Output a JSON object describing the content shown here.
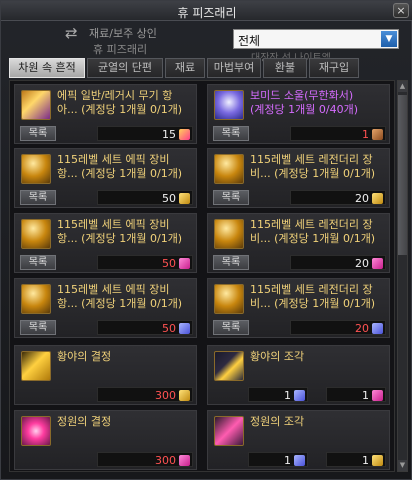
{
  "window": {
    "title": "휴 피즈래리",
    "close_label": "×"
  },
  "shop_info": {
    "line1": "재료/보주 상인",
    "line2": "휴 피즈래리"
  },
  "filter": {
    "selected": "전체",
    "hint": "대장장 선 나이트엘"
  },
  "tabs": [
    {
      "label": "차원 속 흔적",
      "active": true
    },
    {
      "label": "균열의 단편",
      "active": false
    },
    {
      "label": "재료",
      "active": false
    },
    {
      "label": "마법부여",
      "active": false
    },
    {
      "label": "환불",
      "active": false
    },
    {
      "label": "재구입",
      "active": false
    }
  ],
  "list_button_label": "목록",
  "items": [
    {
      "name1": "에픽 일반/레거시 무기 항",
      "name2": "아... (계정당 1개월 0/1개)",
      "name_color": "gold",
      "icon": "epic-chest-icon",
      "costs": [
        {
          "amount": "15",
          "color": "white",
          "currency_icon": "pink-gold-currency-icon"
        }
      ]
    },
    {
      "name1": "보미드 소울(무한화서)",
      "name2": "(계정당 1개월 0/40개)",
      "name_color": "purple",
      "icon": "bomide-soul-icon",
      "costs": [
        {
          "amount": "1",
          "color": "red",
          "currency_icon": "brown-currency-icon"
        }
      ]
    },
    {
      "name1": "115레벨 세트 에픽 장비",
      "name2": "항... (계정당 1개월 0/1개)",
      "name_color": "gold",
      "icon": "set-epic-icon",
      "costs": [
        {
          "amount": "50",
          "color": "white",
          "currency_icon": "gold-shard-currency-icon"
        }
      ]
    },
    {
      "name1": "115레벨 세트 레전더리 장",
      "name2": "비... (계정당 1개월 0/1개)",
      "name_color": "gold",
      "icon": "set-legendary-icon",
      "costs": [
        {
          "amount": "20",
          "color": "white",
          "currency_icon": "gold-shard-currency-icon"
        }
      ]
    },
    {
      "name1": "115레벨 세트 에픽 장비",
      "name2": "항... (계정당 1개월 0/1개)",
      "name_color": "gold",
      "icon": "set-epic-icon",
      "costs": [
        {
          "amount": "50",
          "color": "red",
          "currency_icon": "pink-shard-currency-icon"
        }
      ]
    },
    {
      "name1": "115레벨 세트 레전더리 장",
      "name2": "비... (계정당 1개월 0/1개)",
      "name_color": "gold",
      "icon": "set-legendary-icon",
      "costs": [
        {
          "amount": "20",
          "color": "white",
          "currency_icon": "pink-shard-currency-icon"
        }
      ]
    },
    {
      "name1": "115레벨 세트 에픽 장비",
      "name2": "항... (계정당 1개월 0/1개)",
      "name_color": "gold",
      "icon": "set-epic-icon",
      "costs": [
        {
          "amount": "50",
          "color": "red",
          "currency_icon": "blue-crystal-currency-icon"
        }
      ]
    },
    {
      "name1": "115레벨 세트 레전더리 장",
      "name2": "비... (계정당 1개월 0/1개)",
      "name_color": "gold",
      "icon": "set-legendary-icon",
      "costs": [
        {
          "amount": "20",
          "color": "red",
          "currency_icon": "blue-crystal-currency-icon"
        }
      ]
    },
    {
      "name1": "황야의 결정",
      "name2": "",
      "name_color": "gold",
      "icon": "wilderness-crystal-icon",
      "costs": [
        {
          "amount": "300",
          "color": "red",
          "currency_icon": "gold-shard-currency-icon"
        }
      ]
    },
    {
      "name1": "황야의 조각",
      "name2": "",
      "name_color": "gold",
      "icon": "wilderness-shard-icon",
      "costs": [
        {
          "amount": "1",
          "color": "white",
          "currency_icon": "blue-crystal-currency-icon"
        },
        {
          "amount": "1",
          "color": "white",
          "currency_icon": "pink-shard-currency-icon"
        }
      ]
    },
    {
      "name1": "정원의 결정",
      "name2": "",
      "name_color": "gold",
      "icon": "garden-crystal-icon",
      "costs": [
        {
          "amount": "300",
          "color": "red",
          "currency_icon": "pink-shard-currency-icon"
        }
      ]
    },
    {
      "name1": "정원의 조각",
      "name2": "",
      "name_color": "gold",
      "icon": "garden-shard-icon",
      "costs": [
        {
          "amount": "1",
          "color": "white",
          "currency_icon": "blue-crystal-currency-icon"
        },
        {
          "amount": "1",
          "color": "white",
          "currency_icon": "gold-shard-currency-icon"
        }
      ]
    }
  ]
}
